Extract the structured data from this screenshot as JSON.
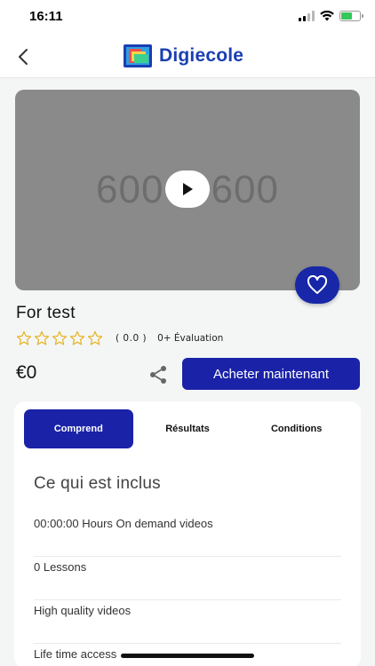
{
  "status_bar": {
    "time": "16:11",
    "icons": [
      "signal-icon",
      "wifi-icon",
      "battery-charging-icon"
    ]
  },
  "header": {
    "back_icon": "chevron-left-icon",
    "brand_name": "Digiecole",
    "brand_color": "#1a3eb3"
  },
  "video": {
    "placeholder_text": "600 × 600",
    "play_icon": "play-icon",
    "favorite_icon": "heart-icon"
  },
  "course": {
    "title": "For test",
    "rating_stars": 0,
    "rating_max": 5,
    "rating_score": "( 0.0 )",
    "rating_count": "0+ Évaluation",
    "price": "€0",
    "share_icon": "share-icon",
    "buy_label": "Acheter maintenant"
  },
  "tabs": [
    {
      "label": "Comprend",
      "active": true
    },
    {
      "label": "Résultats",
      "active": false
    },
    {
      "label": "Conditions",
      "active": false
    }
  ],
  "includes": {
    "heading": "Ce qui est inclus",
    "items": [
      "00:00:00 Hours On demand videos",
      "0 Lessons",
      "High quality videos",
      "Life time access"
    ]
  },
  "colors": {
    "primary": "#1a22a8",
    "background": "#f4f6f6",
    "star": "#e6b422"
  }
}
